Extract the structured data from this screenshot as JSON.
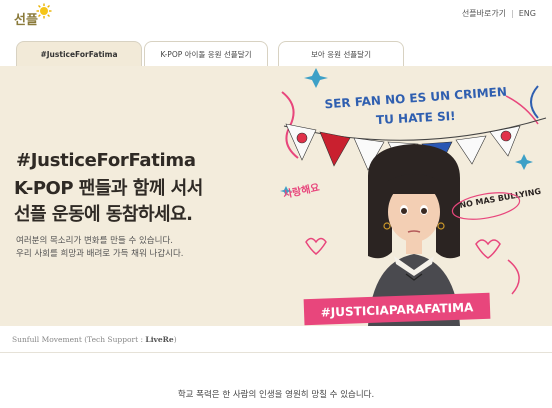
{
  "header": {
    "logo_text": "선플",
    "links": [
      "선플바로가기",
      "ENG"
    ],
    "separator": "|"
  },
  "tabs": [
    {
      "label": "#JusticeForFatima",
      "active": true
    },
    {
      "label": "K-POP 아이돌 응원 선플달기",
      "active": false
    },
    {
      "label": "보아 응원 선플달기",
      "active": false
    }
  ],
  "banner": {
    "hashtag": "#JusticeForFatima",
    "headline_line1": "K-POP 팬들과 함께 서서",
    "headline_line2": "선플 운동에 동참하세요.",
    "sub_line1": "여러분의 목소리가 변화를 만들 수 있습니다.",
    "sub_line2": "우리 사회를 희망과 배려로 가득 채워 나갑시다.",
    "illustration": {
      "banner_top": "SER FAN NO ES UN CRIMEN",
      "banner_bottom": "TU HATE SI!",
      "left_note": "사랑해요",
      "right_note": "NO MAS BULLYING",
      "bottom_tag": "#JUSTICIAPARAFATIMA"
    },
    "colors": {
      "background": "#f3ecdc",
      "accent_pink": "#e8467c",
      "accent_blue": "#2f5fb0"
    }
  },
  "credit": {
    "prefix": "Sunfull Movement (Tech Support : ",
    "brand": "LiveRe",
    "suffix": ")"
  },
  "bottom_text": "학교 폭력은 한 사람의 인생을 영원히 망칠 수 있습니다."
}
